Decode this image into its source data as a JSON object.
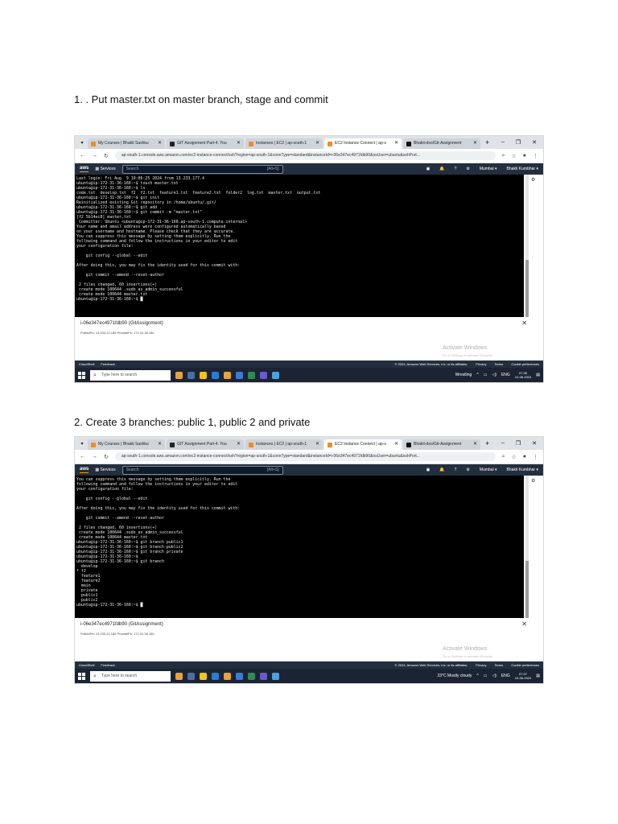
{
  "doc": {
    "steps": [
      {
        "heading": "1. . Put master.txt on master branch, stage and commit",
        "tabs": [
          {
            "label": "My Courses | Bhakti Sashku",
            "color": "#f28b24"
          },
          {
            "label": "GIT Assignment Part-4. You",
            "color": "#222222"
          },
          {
            "label": "Instances | EC2 | ap-south-1",
            "color": "#f28b24"
          },
          {
            "label": "EC2 Instance Connect | ap-s",
            "color": "#f28b24"
          },
          {
            "label": "Bhakti-dso/Git-Assignment",
            "color": "#111111"
          }
        ],
        "url": "ap-south-1.console.aws.amazon.com/ec2-instance-connect/ssh?region=ap-south-1&connType=standard&instanceId=i-06e347ec4971fdb90&osUser=ubuntu&sshPort...",
        "aws": {
          "logo": "aws",
          "services": "Services",
          "search": "Search",
          "shortcut": "[Alt+S]",
          "region": "Mumbai ▾",
          "user": "Bhakti Kumbhar ▾"
        },
        "terminal": [
          "Last login: Fri Aug  9 19:06:25 2024 from 13.233.177.4",
          "ubuntu@ip-172-31-36-160:~$ touch master.txt",
          "ubuntu@ip-172-31-36-160:~$ ls",
          "code.txt  develop.txt  f2  f2.txt  feature1.txt  feature2.txt  folder2  log.txt  master.txt  output.txt",
          "ubuntu@ip-172-31-36-160:~$ git init",
          "Reinitialized existing Git repository in /home/ubuntu/.git/",
          "ubuntu@ip-172-31-36-160:~$ git add .",
          "ubuntu@ip-172-31-36-160:~$ git commit -m \"master.txt\"",
          "[f2 5b14ec8] master.txt",
          " Committer: Ubuntu <ubuntu@ip-172-31-36-160.ap-south-1.compute.internal>",
          "Your name and email address were configured automatically based",
          "on your username and hostname. Please check that they are accurate.",
          "You can suppress this message by setting them explicitly. Run the",
          "following command and follow the instructions in your editor to edit",
          "your configuration file:",
          "",
          "    git config --global --edit",
          "",
          "After doing this, you may fix the identity used for this commit with:",
          "",
          "    git commit --amend --reset-author",
          "",
          " 2 files changed, 60 insertions(+)",
          " create mode 100644 .sudo_as_admin_successful",
          " create mode 100644 master.txt",
          "ubuntu@ip-172-31-36-160:~$ █"
        ],
        "instance": "i-06e347ec4971fdb90 (GitAssignment)",
        "ips": "PublicIPs: 13.233.21.189    PrivateIPs: 172.31.36.160",
        "activate": "Activate Windows",
        "activate_sub": "Go to Settings to activate Windows.",
        "footer": {
          "cloudshell": "CloudShell",
          "feedback": "Feedback",
          "copyright": "© 2024, Amazon Web Services, Inc. or its affiliates.",
          "privacy": "Privacy",
          "terms": "Terms",
          "cookies": "Cookie preferences"
        },
        "taskbar": {
          "search": "Type here to search",
          "weather": "Wrestling",
          "lang": "ENG",
          "time": "07:06",
          "date": "10-08-2024"
        }
      },
      {
        "heading": "2. Create 3 branches: public 1, public 2 and private",
        "tabs": [
          {
            "label": "My Courses | Bhakti Sashku",
            "color": "#f28b24"
          },
          {
            "label": "GIT Assignment Part-4. You",
            "color": "#222222"
          },
          {
            "label": "Instances | EC2 | ap-south-1",
            "color": "#f28b24"
          },
          {
            "label": "EC2 Instance Connect | ap-s",
            "color": "#f28b24"
          },
          {
            "label": "Bhakti-dso/Git-Assignment",
            "color": "#111111"
          }
        ],
        "url": "ap-south-1.console.aws.amazon.com/ec2-instance-connect/ssh?region=ap-south-1&connType=standard&instanceId=i-06e347ec4971fdb90&osUser=ubuntu&sshPort...",
        "aws": {
          "logo": "aws",
          "services": "Services",
          "search": "Search",
          "shortcut": "[Alt+S]",
          "region": "Mumbai ▾",
          "user": "Bhakti Kumbhar ▾"
        },
        "terminal": [
          "You can suppress this message by setting them explicitly. Run the",
          "following command and follow the instructions in your editor to edit",
          "your configuration file:",
          "",
          "    git config --global --edit",
          "",
          "After doing this, you may fix the identity used for this commit with:",
          "",
          "    git commit --amend --reset-author",
          "",
          " 2 files changed, 60 insertions(+)",
          " create mode 100644 .sudo_as_admin_successful",
          " create mode 100644 master.txt",
          "ubuntu@ip-172-31-36-160:~$ git branch public1",
          "ubuntu@ip-172-31-36-160:~$ git branch public2",
          "ubuntu@ip-172-31-36-160:~$ git branch private",
          "ubuntu@ip-172-31-36-160:~$",
          "ubuntu@ip-172-31-36-160:~$ git branch",
          "  develop",
          "* f2",
          "  feature1",
          "  feature2",
          "  main",
          "  private",
          "  public1",
          "  public2",
          "ubuntu@ip-172-31-36-160:~$ █"
        ],
        "instance": "i-06e347ec4971fdb90 (GitAssignment)",
        "ips": "PublicIPs: 13.233.21.189    PrivateIPs: 172.31.36.160",
        "activate": "Activate Windows",
        "activate_sub": "Go to Settings to activate Windows.",
        "footer": {
          "cloudshell": "CloudShell",
          "feedback": "Feedback",
          "copyright": "© 2024, Amazon Web Services, Inc. or its affiliates.",
          "privacy": "Privacy",
          "terms": "Terms",
          "cookies": "Cookie preferences"
        },
        "taskbar": {
          "search": "Type here to search",
          "weather": "23°C  Mostly cloudy",
          "lang": "ENG",
          "time": "07:07",
          "date": "10-08-2024"
        }
      }
    ]
  }
}
